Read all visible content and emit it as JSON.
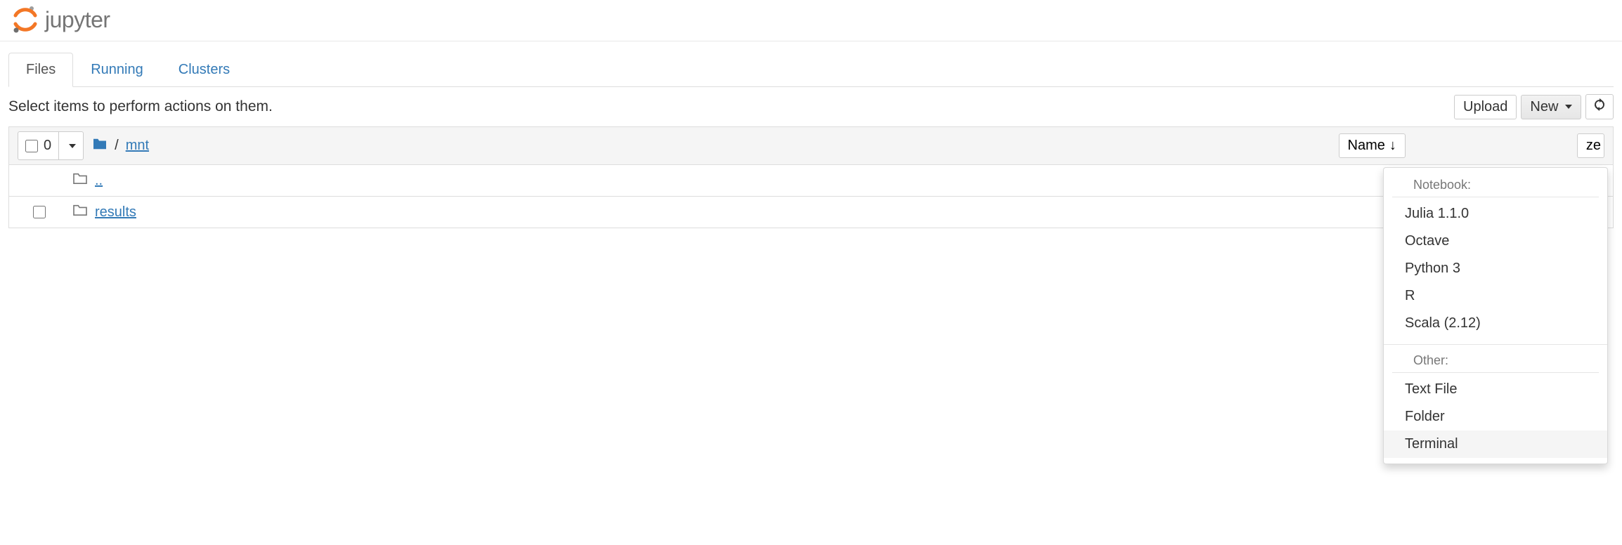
{
  "logo_text": "jupyter",
  "tabs": {
    "files": "Files",
    "running": "Running",
    "clusters": "Clusters"
  },
  "hint": "Select items to perform actions on them.",
  "buttons": {
    "upload": "Upload",
    "new": "New"
  },
  "select_count": "0",
  "breadcrumb": {
    "folder": "mnt"
  },
  "sort": {
    "name": "Name",
    "size_partial": "ze"
  },
  "rows": {
    "up": "..",
    "results": "results"
  },
  "dropdown": {
    "section_notebook": "Notebook:",
    "notebook_items": [
      "Julia 1.1.0",
      "Octave",
      "Python 3",
      "R",
      "Scala (2.12)"
    ],
    "section_other": "Other:",
    "other_items": [
      "Text File",
      "Folder",
      "Terminal"
    ]
  }
}
